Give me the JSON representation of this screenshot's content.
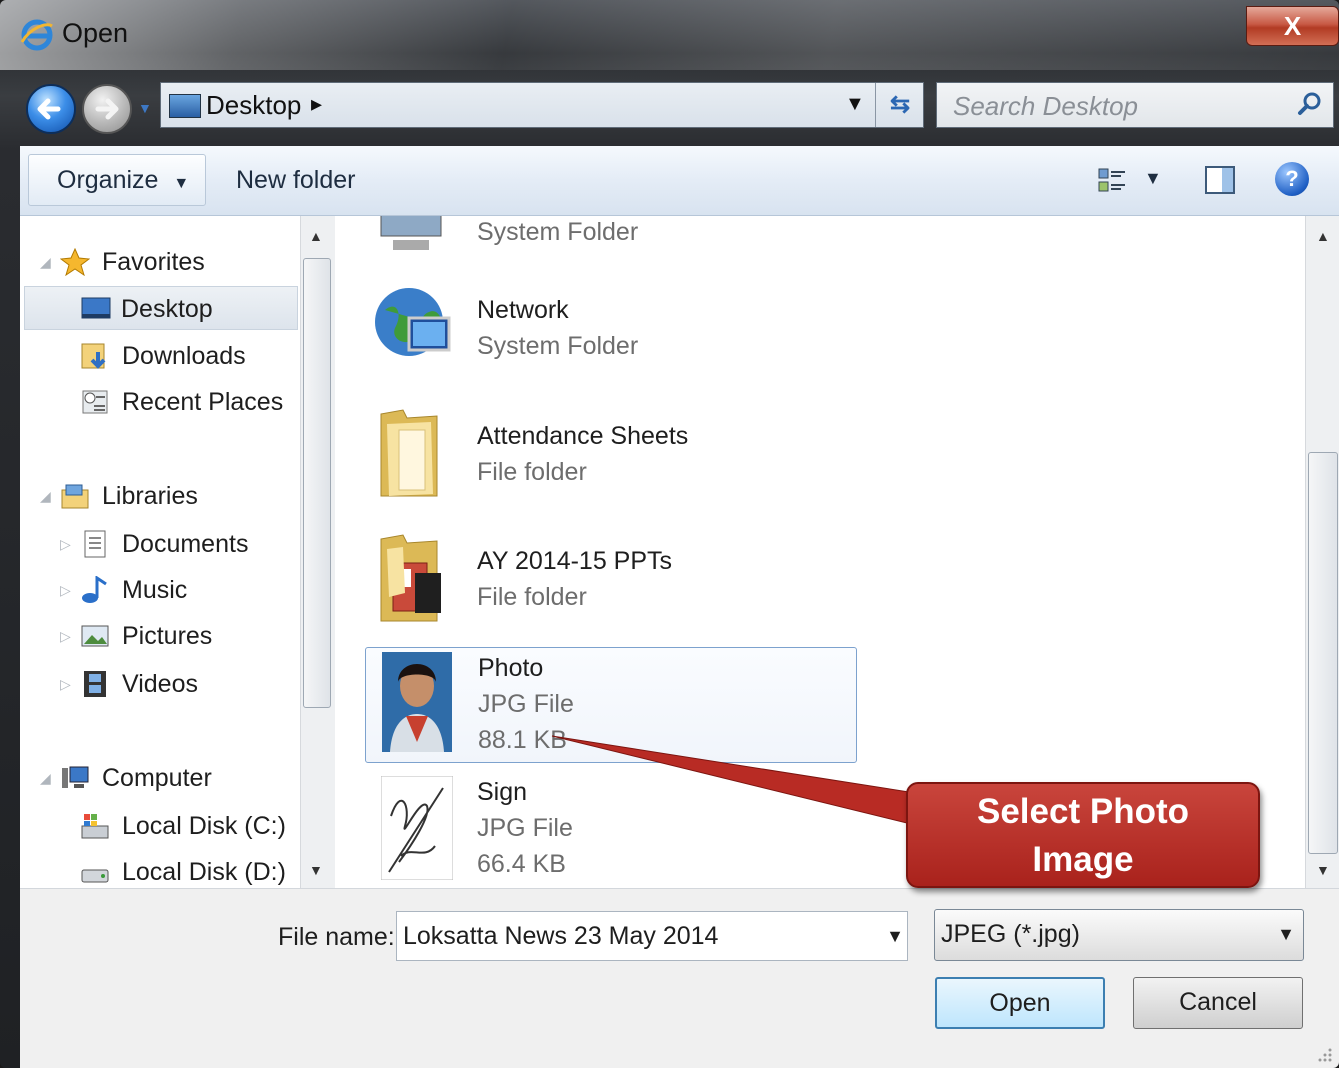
{
  "window": {
    "title": "Open",
    "close_label": "X"
  },
  "nav": {
    "address": "Desktop",
    "search_placeholder": "Search Desktop"
  },
  "toolbar": {
    "organize_label": "Organize",
    "new_folder_label": "New folder"
  },
  "sidebar": {
    "favorites": "Favorites",
    "desktop": "Desktop",
    "downloads": "Downloads",
    "recent_places": "Recent Places",
    "libraries": "Libraries",
    "documents": "Documents",
    "music": "Music",
    "pictures": "Pictures",
    "videos": "Videos",
    "computer": "Computer",
    "local_c": "Local Disk (C:)",
    "local_d": "Local Disk (D:)"
  },
  "files": [
    {
      "name": "",
      "type": "System Folder"
    },
    {
      "name": "Network",
      "type": "System Folder"
    },
    {
      "name": "Attendance Sheets",
      "type": "File folder"
    },
    {
      "name": "AY 2014-15 PPTs",
      "type": "File folder"
    },
    {
      "name": "Photo",
      "type": "JPG File",
      "size": "88.1 KB"
    },
    {
      "name": "Sign",
      "type": "JPG File",
      "size": "66.4 KB"
    }
  ],
  "footer": {
    "file_name_label": "File name:",
    "file_name_value": "Loksatta News 23 May 2014",
    "file_type": "JPEG (*.jpg)",
    "open_label": "Open",
    "cancel_label": "Cancel"
  },
  "callout": {
    "line1": "Select Photo",
    "line2": "Image",
    "color": "#b82b24"
  },
  "colors": {
    "selection_border": "#7da2ce",
    "accent": "#2b67b3"
  }
}
